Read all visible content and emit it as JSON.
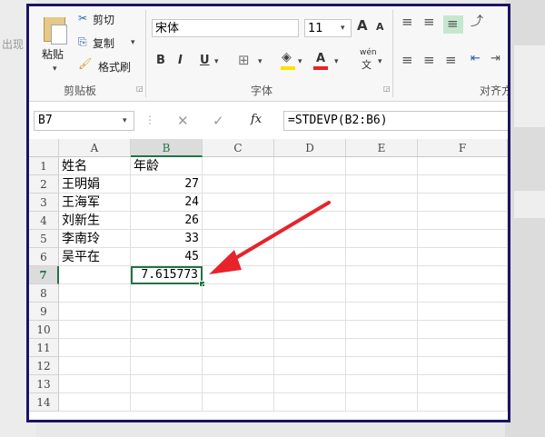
{
  "background": {
    "left_fragment": "出现",
    "accent_border": "#1c1464"
  },
  "ribbon": {
    "clipboard": {
      "paste_label": "粘贴",
      "cut_label": "剪切",
      "copy_label": "复制",
      "format_painter_label": "格式刷",
      "group_label": "剪贴板"
    },
    "font": {
      "font_name": "宋体",
      "font_size": "11",
      "bold": "B",
      "italic": "I",
      "underline": "U",
      "phonetic": "wén",
      "phonetic_sub": "文",
      "grow": "A",
      "shrink": "A",
      "group_label": "字体"
    },
    "alignment": {
      "group_label": "对齐方"
    }
  },
  "formula_bar": {
    "name_box": "B7",
    "cancel": "✕",
    "enter": "✓",
    "fx": "fx",
    "formula": "=STDEVP(B2:B6)"
  },
  "sheet": {
    "columns": [
      "A",
      "B",
      "C",
      "D",
      "E",
      "F"
    ],
    "rows": [
      "1",
      "2",
      "3",
      "4",
      "5",
      "6",
      "7",
      "8",
      "9",
      "10",
      "11",
      "12",
      "13",
      "14"
    ],
    "active_cell": "B7",
    "cells": {
      "A1": "姓名",
      "B1": "年龄",
      "A2": "王明娟",
      "B2": "27",
      "A3": "王海军",
      "B3": "24",
      "A4": "刘新生",
      "B4": "26",
      "A5": "李南玲",
      "B5": "33",
      "A6": "吴平在",
      "B6": "45",
      "B7": "7.615773"
    },
    "accent": "#217346",
    "arrow_color": "#e8232a"
  }
}
